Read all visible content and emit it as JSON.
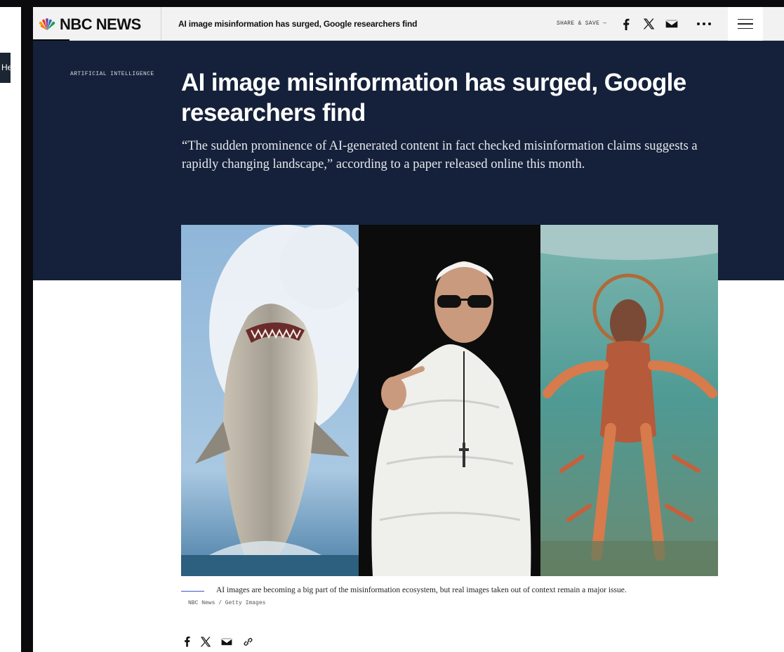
{
  "left_edge": {
    "badge_text": "He"
  },
  "header": {
    "brand": "NBC NEWS",
    "article_title": "AI image misinformation has surged, Google researchers find",
    "share_label": "SHARE & SAVE —",
    "share_icons": [
      "facebook-icon",
      "x-icon",
      "email-icon",
      "more-icon"
    ],
    "menu_icon": "hamburger-icon"
  },
  "article": {
    "kicker": "ARTIFICIAL INTELLIGENCE",
    "headline": "AI image misinformation has surged, Google researchers find",
    "dek": "“The sudden prominence of AI-generated content in fact checked misinformation claims suggests a rapidly changing landscape,” according to a paper released online this month.",
    "image": {
      "panels": [
        "shark-leaping-panel",
        "pope-puffer-jacket-panel",
        "shrimp-jesus-panel"
      ]
    },
    "caption": "AI images are becoming a big part of the misinformation ecosystem, but real images taken out of context remain a major issue.",
    "credit": "NBC News / Getty Images",
    "share_icons": [
      "facebook-icon",
      "x-icon",
      "email-icon",
      "link-icon"
    ]
  },
  "colors": {
    "hero_bg": "#15213a",
    "topbar_bg": "#f2f2f2",
    "caption_rule": "#3a58c9"
  }
}
